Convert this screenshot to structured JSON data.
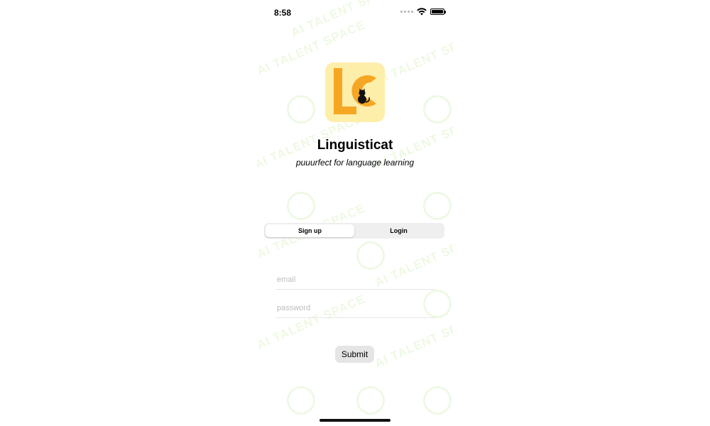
{
  "status_bar": {
    "time": "8:58"
  },
  "app": {
    "name": "Linguisticat",
    "tagline": "puuurfect for language learning",
    "logo_letters": "LC",
    "logo_bg": "#fdeeaa",
    "logo_color": "#f5a623"
  },
  "tabs": [
    {
      "label": "Sign up",
      "selected": true
    },
    {
      "label": "Login",
      "selected": false
    }
  ],
  "form": {
    "email_placeholder": "email",
    "email_value": "",
    "password_placeholder": "password",
    "password_value": "",
    "submit_label": "Submit"
  },
  "icons": [
    "signal-dots-icon",
    "wifi-icon",
    "battery-icon",
    "cat-icon"
  ],
  "watermark": "AI TALENT SPACE"
}
